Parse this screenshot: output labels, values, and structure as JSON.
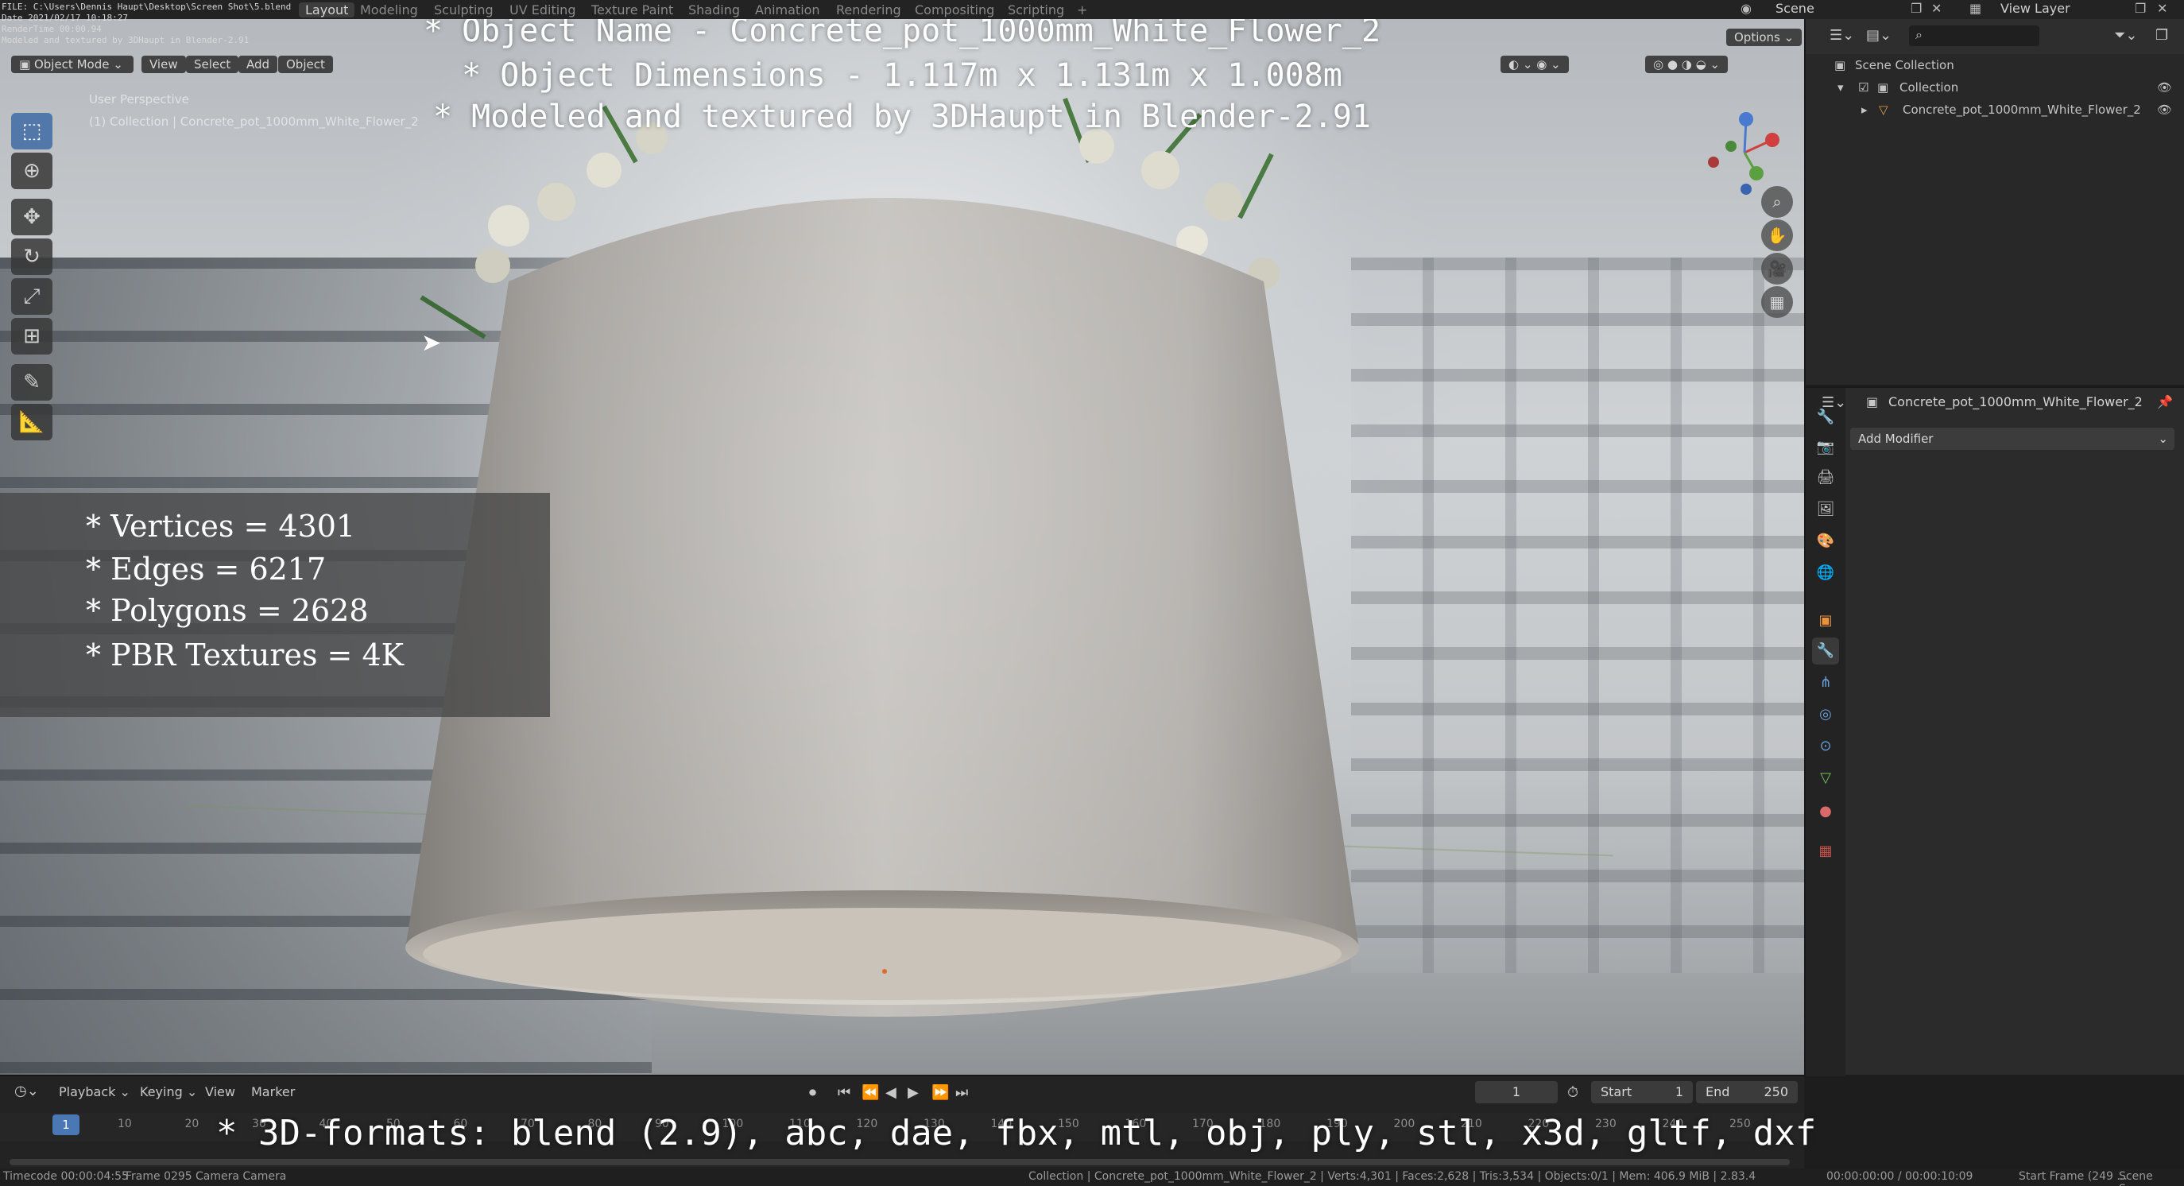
{
  "render_info": {
    "file": "FILE: C:\\Users\\Dennis Haupt\\Desktop\\Screen Shot\\5.blend",
    "date": "Date 2021/02/17 10:18:27",
    "render_time": "RenderTime 00:00.94",
    "note": "Modeled and textured by 3DHaupt in Blender-2.91"
  },
  "topbar": {
    "tabs": [
      "Layout",
      "Modeling",
      "Sculpting",
      "UV Editing",
      "Texture Paint",
      "Shading",
      "Animation",
      "Rendering",
      "Compositing",
      "Scripting",
      "+"
    ],
    "active_tab": "Layout",
    "scene": "Scene",
    "view_layer": "View Layer"
  },
  "viewport": {
    "mode": "Object Mode",
    "menus": [
      "View",
      "Select",
      "Add",
      "Object"
    ],
    "perspective_label": "User Perspective",
    "collection_label": "(1) Collection | Concrete_pot_1000mm_White_Flower_2",
    "options_label": "Options",
    "tools": [
      "select-box-icon",
      "cursor-icon",
      "move-icon",
      "rotate-icon",
      "scale-icon",
      "transform-icon",
      "annotate-icon",
      "measure-icon"
    ],
    "nav_buttons": [
      "zoom-icon",
      "pan-icon",
      "camera-icon",
      "grid-icon"
    ]
  },
  "overlay": {
    "title_lines": [
      "* Object Name - Concrete_pot_1000mm_White_Flower_2",
      "* Object Dimensions - 1.117m x 1.131m x 1.008m",
      "* Modeled and textured by 3DHaupt in Blender-2.91"
    ],
    "stats": [
      "* Vertices = 4301",
      "* Edges = 6217",
      "* Polygons = 2628",
      "* PBR Textures = 4K"
    ],
    "formats": "* 3D-formats: blend (2.9), abc, dae, fbx, mtl, obj, ply, stl, x3d, gltf, dxf"
  },
  "outliner": {
    "root": "Scene Collection",
    "collection": "Collection",
    "object": "Concrete_pot_1000mm_White_Flower_2"
  },
  "properties": {
    "object_name": "Concrete_pot_1000mm_White_Flower_2",
    "add_modifier": "Add Modifier",
    "tab_colors": [
      "#c8c8c8",
      "#c8c8c8",
      "#c8c8c8",
      "#c8c8c8",
      "#d8a06a",
      "#d46a6a",
      "#e8923c",
      "#4f8fe0",
      "#6aa0d8",
      "#6aa0d8",
      "#6aa0d8",
      "#74c05a",
      "#d86a6a",
      "#c0504a"
    ]
  },
  "timeline": {
    "menus": [
      "Playback",
      "Keying",
      "View",
      "Marker"
    ],
    "current_frame": "1",
    "start_label": "Start",
    "start_value": "1",
    "end_label": "End",
    "end_value": "250",
    "ruler_ticks": [
      "10",
      "20",
      "30",
      "40",
      "50",
      "60",
      "70",
      "80",
      "90",
      "100",
      "110",
      "120",
      "130",
      "140",
      "150",
      "160",
      "170",
      "180",
      "190",
      "200",
      "210",
      "220",
      "230",
      "240",
      "250"
    ],
    "playhead": "1"
  },
  "statusbar": {
    "left": "Timecode 00:00:04:55",
    "frame": "Frame 0295",
    "camera": "Camera Camera",
    "center": "Collection | Concrete_pot_1000mm_White_Flower_2 | Verts:4,301 | Faces:2,628 | Tris:3,534 | Objects:0/1 | Mem: 406.9 MiB | 2.83.4",
    "time": "00:00:00:00 / 00:00:10:09",
    "start_frame": "Start Frame (249 ...",
    "scene": "Scene Scene"
  }
}
